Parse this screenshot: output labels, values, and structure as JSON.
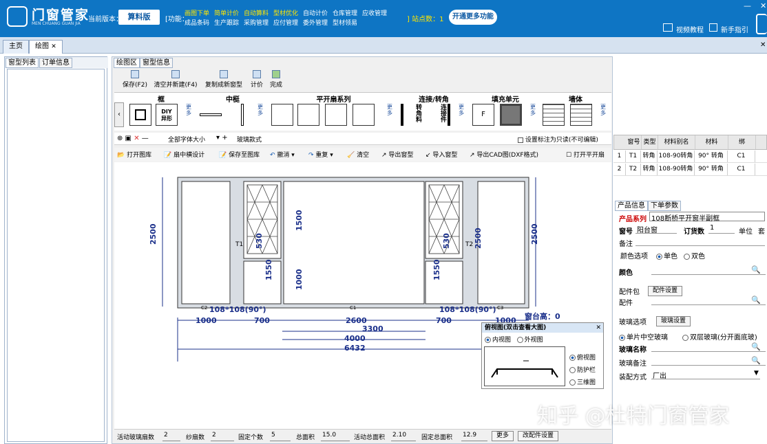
{
  "app": {
    "logo_title": "门窗管家",
    "logo_sub": "MEN CHUANG GUAN JIA",
    "version_label": "当前版本：",
    "version": "算料版",
    "func_label": "[功能：",
    "site_count": "] 站点数：1",
    "open_more": "开通更多功能",
    "video": "视频教程",
    "guide": "新手指引"
  },
  "functions": [
    {
      "label": "画图下单",
      "color": "#ffe600"
    },
    {
      "label": "简单计价",
      "color": "#ffe600"
    },
    {
      "label": "自动算料",
      "color": "#ffe600"
    },
    {
      "label": "型材优化",
      "color": "#ffe600"
    },
    {
      "label": "自动计价",
      "color": "#ffffff"
    },
    {
      "label": "仓库管理",
      "color": "#ffffff"
    },
    {
      "label": "应收管理",
      "color": "#ffffff"
    },
    {
      "label": "成品条码",
      "color": "#ffffff"
    },
    {
      "label": "生产跟踪",
      "color": "#ffffff"
    },
    {
      "label": "采购管理",
      "color": "#ffffff"
    },
    {
      "label": "应付管理",
      "color": "#ffffff"
    },
    {
      "label": "委外管理",
      "color": "#ffffff"
    },
    {
      "label": "型材领易",
      "color": "#ffffff"
    }
  ],
  "tabs": {
    "home": "主页",
    "draw": "绘图"
  },
  "left": {
    "tab1": "窗型列表",
    "tab2": "订单信息"
  },
  "center_tabs": {
    "draw_area": "绘图区",
    "type_info": "窗型信息"
  },
  "toolbar": {
    "save": "保存(F2)",
    "clear_new": "清空并新建(F4)",
    "copy_new": "复制成新窗型",
    "price": "计价",
    "done": "完成"
  },
  "categories": {
    "frame": "框",
    "mullion": "中梃",
    "casement": "平开扇系列",
    "connect": "连接/转角",
    "fill": "填充单元",
    "wall": "墙体",
    "more": "更多",
    "diy": "DIY\n异形",
    "corner": "转角料",
    "connector": "连接件",
    "f": "F"
  },
  "options": {
    "font_size": "全部字体大小",
    "glass": "玻璃款式",
    "readonly": "设置标注为只读(不可编辑)"
  },
  "tools": {
    "open_lib": "打开图库",
    "mid_design": "扇中横设计",
    "save_lib": "保存至图库",
    "undo": "撤消",
    "redo": "重复",
    "clear": "清空",
    "export_type": "导出窗型",
    "import_type": "导入窗型",
    "export_cad": "导出CAD图(DXF格式)",
    "open_casement": "打开平开扇"
  },
  "drawing": {
    "h_dims": [
      "1000",
      "700",
      "2600",
      "700",
      "1000"
    ],
    "total_3300": "3300",
    "total_4000": "4000",
    "total_6432": "6432",
    "height_2500": "2500",
    "v_1500": "1500",
    "v_1000": "1000",
    "v_530": "530",
    "v_1550": "1550",
    "t1": "T1",
    "t2": "T2",
    "c1": "C1",
    "c2": "C2",
    "c3": "C3",
    "corner_label": "108*108(90°)",
    "sill": "窗台高：0"
  },
  "bottom": {
    "glass_sash_label": "活动玻璃扇数",
    "glass_sash": "2",
    "screen_label": "纱扇数",
    "screen": "2",
    "fixed_label": "固定个数",
    "fixed": "5",
    "area_label": "总面积",
    "area": "15.0",
    "active_area_label": "活动总面积",
    "active_area": "2.10",
    "fixed_area_label": "固定总面积",
    "fixed_area": "12.9",
    "more": "更多",
    "hardware": "改配件设置"
  },
  "grid": {
    "headers": [
      "窗号",
      "类型",
      "材料别名",
      "材料",
      "绑"
    ],
    "rows": [
      [
        "1",
        "T1",
        "转角料",
        "108-90转角",
        "90° 转角",
        "C1"
      ],
      [
        "2",
        "T2",
        "转角料",
        "108-90转角",
        "90° 转角",
        "C1"
      ]
    ]
  },
  "props": {
    "tab1": "产品信息",
    "tab2": "下单参数",
    "series_label": "产品系列",
    "series": "108断桥平开窗半副框",
    "window_no_label": "窗号",
    "window_no": "阳台窗",
    "qty_label": "订货数",
    "qty": "1",
    "unit_label": "单位",
    "unit": "套",
    "remark_label": "备注",
    "color_opt_label": "颜色选项",
    "single": "单色",
    "double": "双色",
    "color_label": "颜色",
    "pack_label": "配件包",
    "pack_btn": "配件设置",
    "hw_label": "配件",
    "glass_opt_label": "玻璃选项",
    "glass_btn": "玻璃设置",
    "single_glass": "单片中空玻璃",
    "double_glass": "双层玻璃(分开面底玻)",
    "glass_name_label": "玻璃名称",
    "glass_remark_label": "玻璃备注",
    "install_label": "装配方式",
    "install": "厂出"
  },
  "preview": {
    "title": "俯视图(双击查看大图)",
    "inner": "内视图",
    "outer": "外视图",
    "top": "俯视图",
    "guard": "防护栏",
    "three": "三维图"
  },
  "watermark": "知乎 @杜特门窗管家"
}
